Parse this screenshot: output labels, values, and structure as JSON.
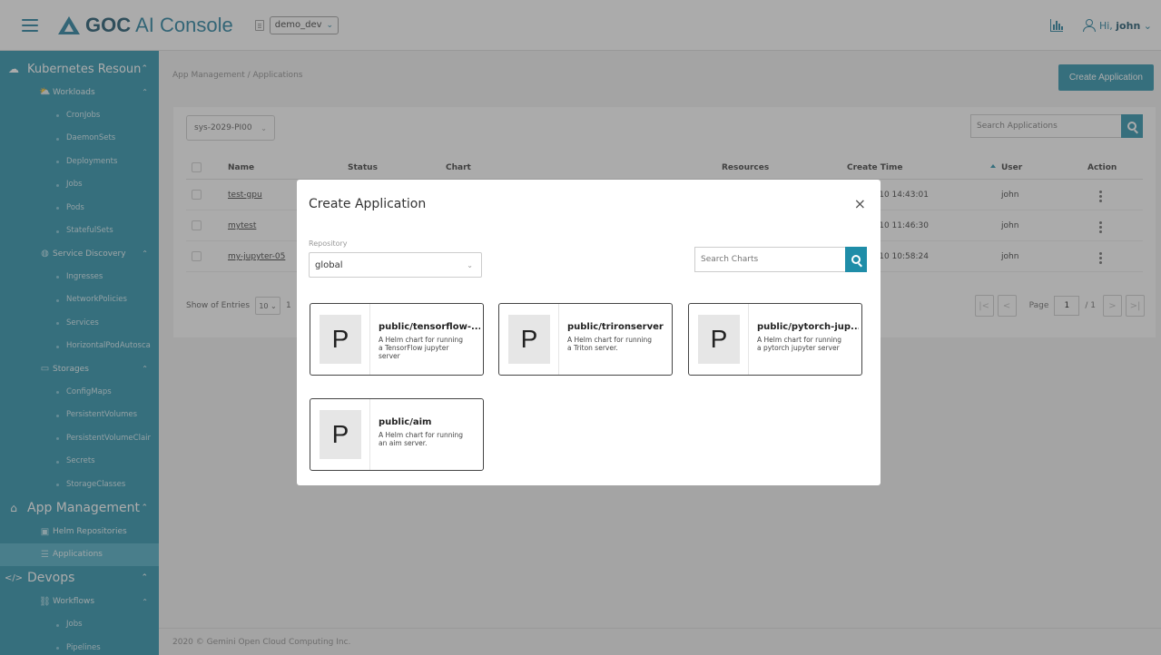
{
  "header": {
    "brand_bold": "GOC",
    "brand_rest": "AI Console",
    "namespace": "demo_dev",
    "greeting_prefix": "Hi, ",
    "username": "john",
    "colors": {
      "primary": "#1f8da8",
      "brand_dark": "#124e66"
    }
  },
  "sidebar": {
    "kubernetes": {
      "label": "Kubernetes Resoun",
      "workloads": {
        "label": "Workloads",
        "items": [
          "CronJobs",
          "DaemonSets",
          "Deployments",
          "Jobs",
          "Pods",
          "StatefulSets"
        ]
      },
      "service_discovery": {
        "label": "Service Discovery",
        "items": [
          "Ingresses",
          "NetworkPolicies",
          "Services",
          "HorizontalPodAutosca"
        ]
      },
      "storages": {
        "label": "Storages",
        "items": [
          "ConfigMaps",
          "PersistentVolumes",
          "PersistentVolumeClair",
          "Secrets",
          "StorageClasses"
        ]
      }
    },
    "app_management": {
      "label": "App Management",
      "items": [
        "Helm Repositories",
        "Applications"
      ]
    },
    "devops": {
      "label": "Devops",
      "workflows": {
        "label": "Workflows",
        "items": [
          "Jobs",
          "Pipelines"
        ]
      }
    }
  },
  "main": {
    "breadcrumb": "App Management / Applications",
    "create_button": "Create Application",
    "project": "sys-2029-PI00",
    "search_placeholder": "Search Applications",
    "columns": [
      "Name",
      "Status",
      "Chart",
      "Resources",
      "Create Time",
      "User",
      "Action"
    ],
    "rows": [
      {
        "name": "test-gpu",
        "time": "-10 14:43:01",
        "user": "john"
      },
      {
        "name": "mytest",
        "time": "-10 11:46:30",
        "user": "john"
      },
      {
        "name": "my-jupyter-05",
        "time": "-10 10:58:24",
        "user": "john"
      }
    ],
    "pager": {
      "show_label": "Show of Entries",
      "per_page": "10",
      "range_text": "1",
      "page_label": "Page",
      "page": "1",
      "total": "/ 1"
    },
    "footer": "2020 © Gemini Open Cloud Computing Inc."
  },
  "modal": {
    "title": "Create Application",
    "close": "×",
    "repository_label": "Repository",
    "repository": "global",
    "search_placeholder": "Search Charts",
    "charts": [
      {
        "letter": "P",
        "name": "public/tensorflow-...",
        "desc": "A Helm chart for running a TensorFlow jupyter server"
      },
      {
        "letter": "P",
        "name": "public/trironserver",
        "desc": "A Helm chart for running a Triton server."
      },
      {
        "letter": "P",
        "name": "public/pytorch-jup...",
        "desc": "A Helm chart for running a pytorch jupyter server"
      },
      {
        "letter": "P",
        "name": "public/aim",
        "desc": "A Helm chart for running an aim server."
      }
    ]
  }
}
